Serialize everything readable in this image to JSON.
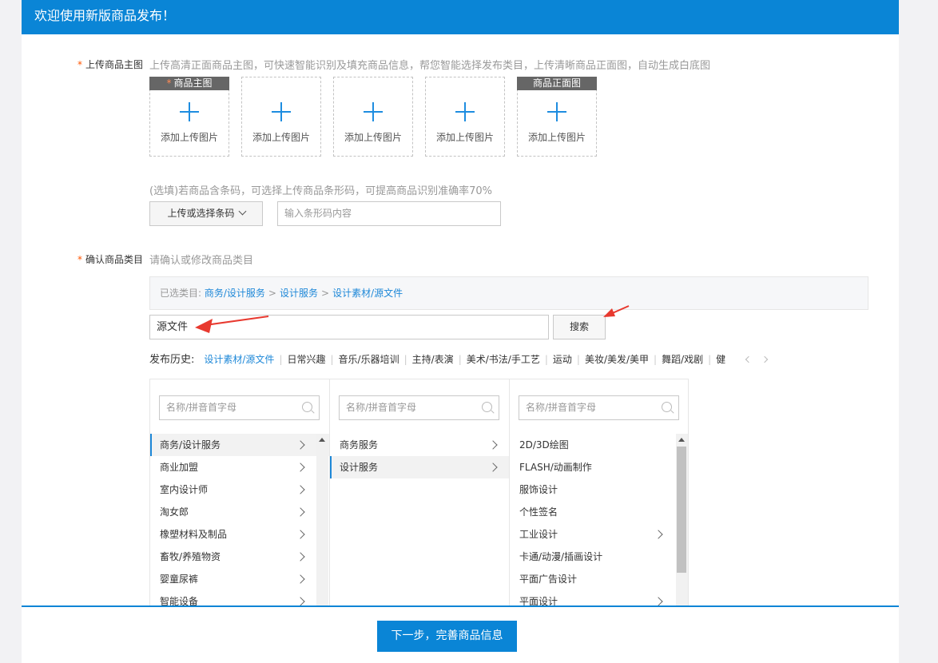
{
  "header": {
    "title": "欢迎使用新版商品发布！"
  },
  "main_image": {
    "label": "上传商品主图",
    "hint": "上传高清正面商品主图，可快速智能识别及填充商品信息，帮您智能选择发布类目，上传清晰商品正面图，自动生成白底图",
    "slots": [
      {
        "tag": "商品主图",
        "add": "添加上传图片"
      },
      {
        "tag": "",
        "add": "添加上传图片"
      },
      {
        "tag": "",
        "add": "添加上传图片"
      },
      {
        "tag": "",
        "add": "添加上传图片"
      },
      {
        "tag": "商品正面图",
        "add": "添加上传图片"
      }
    ]
  },
  "barcode": {
    "hint": "(选填)若商品含条码，可选择上传商品条形码，可提高商品识别准确率70%",
    "button": "上传或选择条码",
    "placeholder": "输入条形码内容"
  },
  "category": {
    "label": "确认商品类目",
    "hint": "请确认或修改商品类目",
    "selected_prefix": "已选类目:",
    "selected_path": [
      "商务/设计服务",
      "设计服务",
      "设计素材/源文件"
    ],
    "search_value": "源文件",
    "search_button": "搜索",
    "history_title": "发布历史:",
    "history": [
      "设计素材/源文件",
      "日常兴趣",
      "音乐/乐器培训",
      "主持/表演",
      "美术/书法/手工艺",
      "运动",
      "美妆/美发/美甲",
      "舞蹈/戏剧",
      "健"
    ],
    "columns": [
      {
        "placeholder": "名称/拼音首字母",
        "scroll_fraction": 0.0,
        "items": [
          {
            "label": "商务/设计服务",
            "arrow": true,
            "selected": true
          },
          {
            "label": "商业加盟",
            "arrow": true
          },
          {
            "label": "室内设计师",
            "arrow": true
          },
          {
            "label": "淘女郎",
            "arrow": true
          },
          {
            "label": "橡塑材料及制品",
            "arrow": true
          },
          {
            "label": "畜牧/养殖物资",
            "arrow": true
          },
          {
            "label": "婴童尿裤",
            "arrow": true
          },
          {
            "label": "智能设备",
            "arrow": true
          }
        ]
      },
      {
        "placeholder": "名称/拼音首字母",
        "items": [
          {
            "label": "商务服务",
            "arrow": true
          },
          {
            "label": "设计服务",
            "arrow": true,
            "selected": true
          }
        ]
      },
      {
        "placeholder": "名称/拼音首字母",
        "scroll_fraction": 0.0,
        "items": [
          {
            "label": "2D/3D绘图",
            "arrow": false
          },
          {
            "label": "FLASH/动画制作",
            "arrow": false
          },
          {
            "label": "服饰设计",
            "arrow": false
          },
          {
            "label": "个性签名",
            "arrow": false
          },
          {
            "label": "工业设计",
            "arrow": true
          },
          {
            "label": "卡通/动漫/插画设计",
            "arrow": false
          },
          {
            "label": "平面广告设计",
            "arrow": false
          },
          {
            "label": "平面设计",
            "arrow": true
          }
        ]
      }
    ]
  },
  "footer": {
    "next_button": "下一步，完善商品信息"
  },
  "colors": {
    "primary": "#0a85d6",
    "link": "#1e88d8",
    "required": "#ff5500",
    "annotation_arrow": "#e8392f"
  }
}
